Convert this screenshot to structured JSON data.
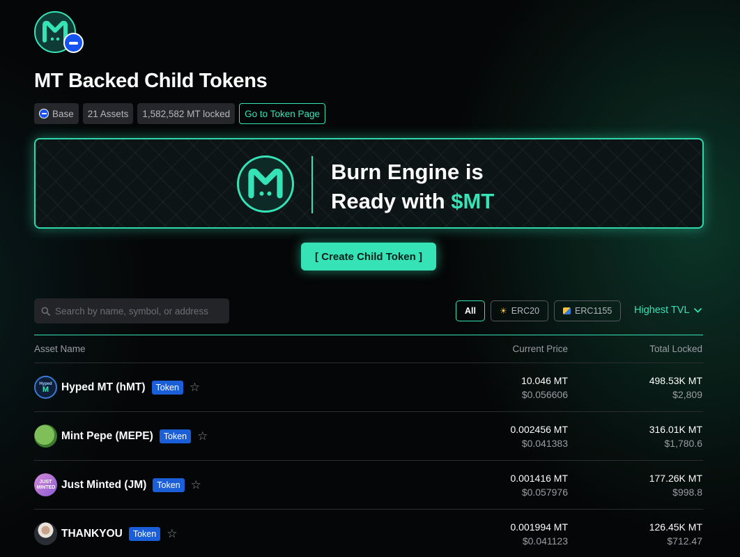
{
  "header": {
    "title": "MT Backed Child Tokens",
    "chips": {
      "chain": "Base",
      "assets": "21 Assets",
      "locked": "1,582,582 MT locked",
      "token_page_link": "Go to Token Page"
    }
  },
  "banner": {
    "line1": "Burn Engine is",
    "line2_prefix": "Ready with ",
    "line2_accent": "$MT"
  },
  "create_button": "[ Create Child Token ]",
  "search": {
    "placeholder": "Search by name, symbol, or address"
  },
  "filters": {
    "all": "All",
    "erc20": "ERC20",
    "erc1155": "ERC1155"
  },
  "sort": {
    "label": "Highest TVL"
  },
  "table": {
    "headers": {
      "name": "Asset Name",
      "price": "Current Price",
      "locked": "Total Locked"
    },
    "rows": [
      {
        "name": "Hyped MT (hMT)",
        "badge": "Token",
        "avatar": "Hyped",
        "price_mt": "10.046 MT",
        "price_usd": "$0.056606",
        "locked_mt": "498.53K MT",
        "locked_usd": "$2,809"
      },
      {
        "name": "Mint Pepe (MEPE)",
        "badge": "Token",
        "avatar": "",
        "price_mt": "0.002456 MT",
        "price_usd": "$0.041383",
        "locked_mt": "316.01K MT",
        "locked_usd": "$1,780.6"
      },
      {
        "name": "Just Minted (JM)",
        "badge": "Token",
        "avatar": "JUST MINTED",
        "price_mt": "0.001416 MT",
        "price_usd": "$0.057976",
        "locked_mt": "177.26K MT",
        "locked_usd": "$998.8"
      },
      {
        "name": "THANKYOU",
        "badge": "Token",
        "avatar": "",
        "price_mt": "0.001994 MT",
        "price_usd": "$0.041123",
        "locked_mt": "126.45K MT",
        "locked_usd": "$712.47"
      }
    ]
  },
  "colors": {
    "accent": "#35e3b6",
    "badge": "#1b5fd8",
    "base_blue": "#1652f0",
    "background": "#050607"
  }
}
